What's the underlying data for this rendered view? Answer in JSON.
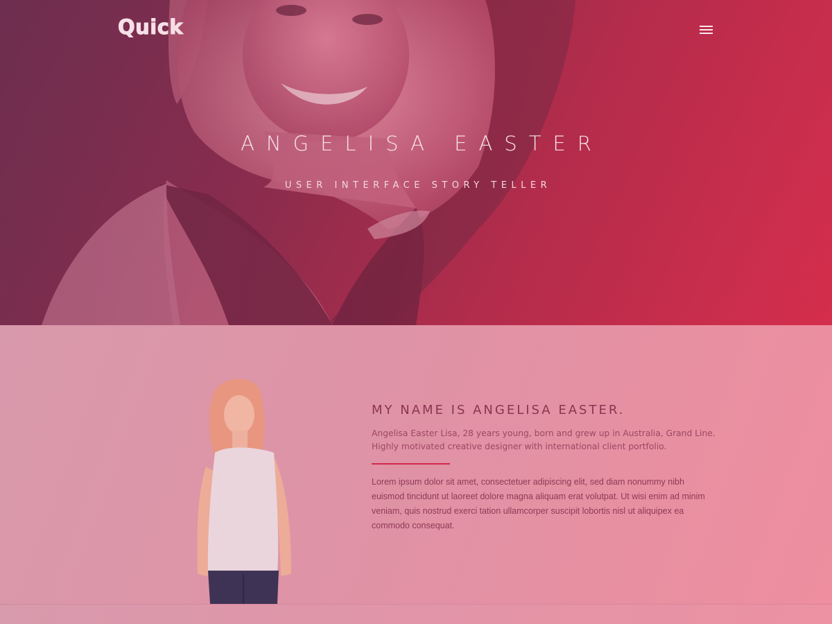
{
  "brand": {
    "logo_text": "Quick"
  },
  "nav": {
    "menu_icon": "hamburger-menu-icon"
  },
  "hero": {
    "title": "ANGELISA EASTER",
    "subtitle": "USER INTERFACE STORY TELLER"
  },
  "about": {
    "heading": "MY NAME IS ANGELISA EASTER.",
    "intro": "Angelisa Easter Lisa, 28 years young, born and grew up in Australia, Grand Line. Highly motivated creative designer with international client portfolio.",
    "body": "Lorem ipsum dolor sit amet, consectetuer adipiscing elit, sed diam nonummy nibh euismod tincidunt ut laoreet dolore magna aliquam erat volutpat. Ut wisi enim ad minim veniam, quis nostrud exerci tation ullamcorper suscipit lobortis nisl ut aliquipex ea commodo consequat."
  },
  "colors": {
    "accent": "#d22a4c",
    "hero_gradient_start": "#6d2f4f",
    "hero_gradient_end": "#d22e4c",
    "about_background": "#e092a5"
  }
}
